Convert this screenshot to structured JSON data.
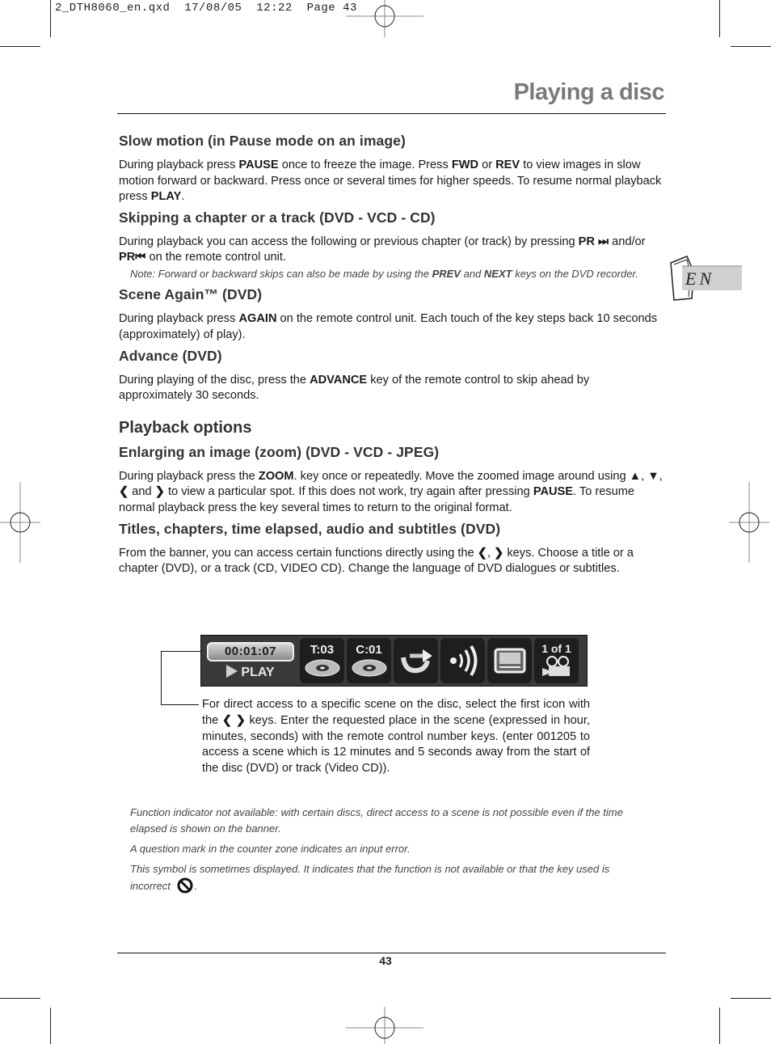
{
  "slug": {
    "file": "2_DTH8060_en.qxd",
    "date": "17/08/05",
    "time": "12:22",
    "page_label": "Page 43"
  },
  "header": {
    "title": "Playing a disc"
  },
  "language_tab": {
    "label": "EN"
  },
  "sections": [
    {
      "heading": "Slow motion (in Pause mode on an image)",
      "body": [
        {
          "t": "During playback press "
        },
        {
          "b": "PAUSE"
        },
        {
          "t": " once to freeze the image. Press "
        },
        {
          "b": "FWD"
        },
        {
          "t": " or "
        },
        {
          "b": "REV"
        },
        {
          "t": " to view images in slow motion forward or backward. Press once or several times for higher speeds. To resume normal playback press "
        },
        {
          "b": "PLAY"
        },
        {
          "t": "."
        }
      ]
    },
    {
      "heading": "Skipping a chapter or a track (DVD - VCD - CD)",
      "body": [
        {
          "t": "During playback you can access the following or previous chapter (or track) by pressing "
        },
        {
          "b": "PR ⏭"
        },
        {
          "t": " and/or "
        },
        {
          "b": "PR⏮"
        },
        {
          "t": "  on the remote control unit."
        }
      ],
      "note": [
        {
          "t": "Note: Forward or backward skips can also be made by using the "
        },
        {
          "b": "PREV"
        },
        {
          "t": " and "
        },
        {
          "b": "NEXT"
        },
        {
          "t": " keys on the DVD recorder."
        }
      ]
    },
    {
      "heading": "Scene Again™ (DVD)",
      "body": [
        {
          "t": "During playback press "
        },
        {
          "b": "AGAIN"
        },
        {
          "t": " on the remote control unit. Each touch of the key steps back 10 seconds (approximately) of play)."
        }
      ]
    },
    {
      "heading": "Advance (DVD)",
      "body": [
        {
          "t": "During playing of the disc, press the "
        },
        {
          "b": "ADVANCE"
        },
        {
          "t": " key of the remote control to skip ahead by approximately 30 seconds."
        }
      ]
    }
  ],
  "playback_options": {
    "title": "Playback options",
    "sections": [
      {
        "heading": "Enlarging an image (zoom) (DVD - VCD - JPEG)",
        "body": [
          {
            "t": "During playback press the "
          },
          {
            "b": "ZOOM"
          },
          {
            "t": ". key once or repeatedly. Move the zoomed image around using "
          },
          {
            "b": "▲"
          },
          {
            "t": ", "
          },
          {
            "b": "▼"
          },
          {
            "t": ", "
          },
          {
            "b": "❮"
          },
          {
            "t": " and "
          },
          {
            "b": "❯"
          },
          {
            "t": " to view a particular spot. If this does not work, try again after pressing "
          },
          {
            "b": "PAUSE"
          },
          {
            "t": ". To resume normal playback press the key several times to return to the original format."
          }
        ]
      },
      {
        "heading": "Titles, chapters, time elapsed, audio and subtitles (DVD)",
        "body": [
          {
            "t": "From the banner, you can access certain functions directly using the "
          },
          {
            "b": "❮"
          },
          {
            "t": ", "
          },
          {
            "b": "❯"
          },
          {
            "t": " keys. Choose a title or a chapter (DVD), or a track (CD, VIDEO CD). Change the language of DVD dialogues or subtitles."
          }
        ]
      }
    ]
  },
  "banner": {
    "counter": "00:01:07",
    "status": "PLAY",
    "title_label": "T:03",
    "chapter_label": "C:01",
    "angle_label": "1 of 1",
    "icons": [
      "time-counter",
      "title-disc-icon",
      "chapter-disc-icon",
      "repeat-icon",
      "audio-icon",
      "subtitle-screen-icon",
      "camera-angle-icon"
    ]
  },
  "callout": {
    "text": [
      {
        "t": "For direct access to a specific scene on the disc, select the first icon with the "
      },
      {
        "b": "❮ ❯"
      },
      {
        "t": " keys. Enter the requested place in the scene (expressed in hour, minutes, seconds) with the remote control number keys. (enter 001205 to access a scene which is 12 minutes and 5 seconds away from the start of the disc (DVD) or track (Video CD))."
      }
    ]
  },
  "footnotes": [
    "Function indicator not available: with certain discs, direct access to a scene is not possible even if the time elapsed is shown on the banner.",
    "A question mark in the counter zone indicates an input error.",
    "This symbol is sometimes displayed. It indicates that the function is not available or that the key used is incorrect"
  ],
  "footer": {
    "page_number": "43"
  }
}
